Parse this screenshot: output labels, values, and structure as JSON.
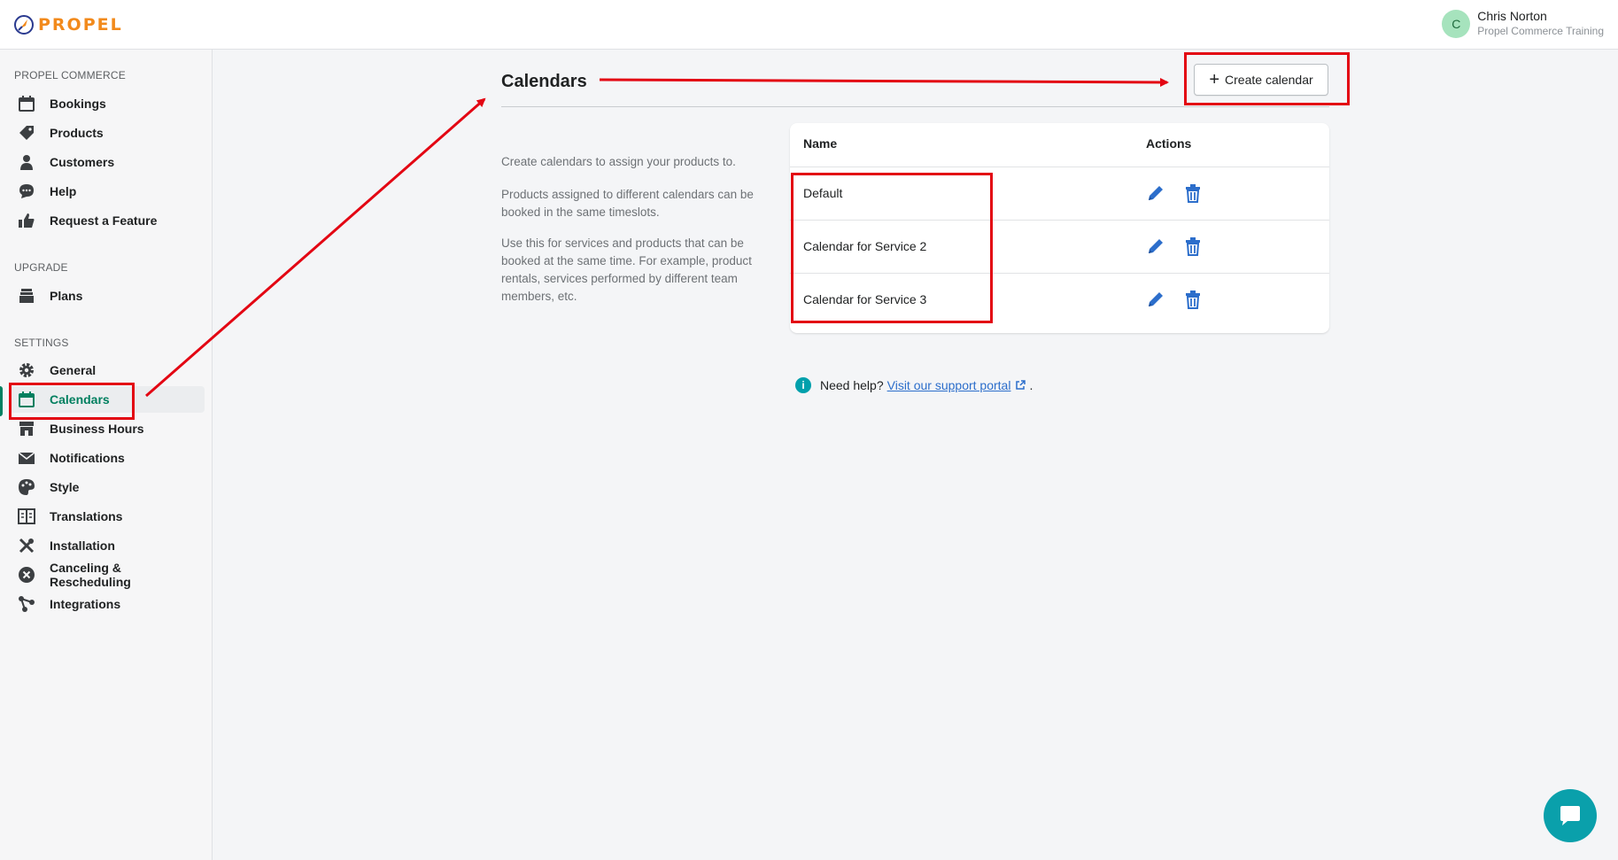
{
  "brand": {
    "name": "PROPEL",
    "color": "#f28a1c"
  },
  "user": {
    "initial": "C",
    "name": "Chris Norton",
    "org": "Propel Commerce Training"
  },
  "sidebar": {
    "sections": [
      {
        "title": "PROPEL COMMERCE"
      },
      {
        "title": "UPGRADE"
      },
      {
        "title": "SETTINGS"
      }
    ],
    "items": [
      {
        "label": "Bookings",
        "icon": "calendar-icon"
      },
      {
        "label": "Products",
        "icon": "tag-icon"
      },
      {
        "label": "Customers",
        "icon": "person-icon"
      },
      {
        "label": "Help",
        "icon": "chat-bubble-icon"
      },
      {
        "label": "Request a Feature",
        "icon": "thumbs-up-icon"
      },
      {
        "label": "Plans",
        "icon": "stack-icon"
      },
      {
        "label": "General",
        "icon": "gear-icon"
      },
      {
        "label": "Calendars",
        "icon": "calendar-icon",
        "active": true
      },
      {
        "label": "Business Hours",
        "icon": "store-icon"
      },
      {
        "label": "Notifications",
        "icon": "envelope-icon"
      },
      {
        "label": "Style",
        "icon": "palette-icon"
      },
      {
        "label": "Translations",
        "icon": "book-icon"
      },
      {
        "label": "Installation",
        "icon": "tools-icon"
      },
      {
        "label": "Canceling & Rescheduling",
        "icon": "x-circle-icon"
      },
      {
        "label": "Integrations",
        "icon": "nodes-icon"
      }
    ]
  },
  "main": {
    "title": "Calendars",
    "create_button": "Create calendar",
    "description": [
      "Create calendars to assign your products to.",
      "Products assigned to different calendars can be booked in the same timeslots.",
      "Use this for services and products that can be booked at the same time. For example, product rentals, services performed by different team members, etc."
    ],
    "table": {
      "headers": {
        "name": "Name",
        "actions": "Actions"
      },
      "rows": [
        {
          "name": "Default"
        },
        {
          "name": "Calendar for Service 2"
        },
        {
          "name": "Calendar for Service 3"
        }
      ]
    },
    "help": {
      "prefix": "Need help?",
      "link": "Visit our support portal",
      "suffix": "."
    }
  },
  "colors": {
    "accent": "#008060",
    "action": "#2c6ecb",
    "annotation": "#e30613",
    "chat": "#0aa0ab"
  }
}
